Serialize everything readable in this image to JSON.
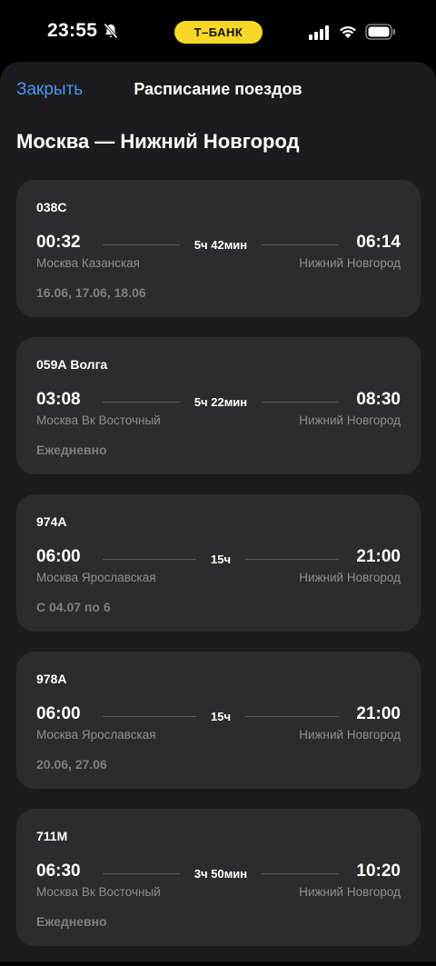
{
  "status_bar": {
    "time": "23:55",
    "bank_label": "Т–БАНК",
    "icons": [
      "bell-muted-icon",
      "signal-icon",
      "wifi-icon",
      "battery-icon"
    ]
  },
  "nav": {
    "close_label": "Закрыть",
    "title": "Расписание поездов"
  },
  "route": {
    "title": "Москва — Нижний Новгород"
  },
  "colors": {
    "accent": "#4a93f0",
    "bank_yellow": "#f6d826",
    "card_bg": "#2c2c2e",
    "sheet_bg": "#1c1c1e"
  },
  "trains": [
    {
      "number": "038С",
      "departure_time": "00:32",
      "arrival_time": "06:14",
      "duration": "5ч 42мин",
      "departure_station": "Москва Казанская",
      "arrival_station": "Нижний Новгород",
      "days": "16.06, 17.06, 18.06"
    },
    {
      "number": "059А Волга",
      "departure_time": "03:08",
      "arrival_time": "08:30",
      "duration": "5ч 22мин",
      "departure_station": "Москва Вк Восточный",
      "arrival_station": "Нижний Новгород",
      "days": "Ежедневно"
    },
    {
      "number": "974А",
      "departure_time": "06:00",
      "arrival_time": "21:00",
      "duration": "15ч",
      "departure_station": "Москва Ярославская",
      "arrival_station": "Нижний Новгород",
      "days": "С 04.07 по 6"
    },
    {
      "number": "978А",
      "departure_time": "06:00",
      "arrival_time": "21:00",
      "duration": "15ч",
      "departure_station": "Москва Ярославская",
      "arrival_station": "Нижний Новгород",
      "days": "20.06, 27.06"
    },
    {
      "number": "711М",
      "departure_time": "06:30",
      "arrival_time": "10:20",
      "duration": "3ч 50мин",
      "departure_station": "Москва Вк Восточный",
      "arrival_station": "Нижний Новгород",
      "days": "Ежедневно"
    }
  ]
}
